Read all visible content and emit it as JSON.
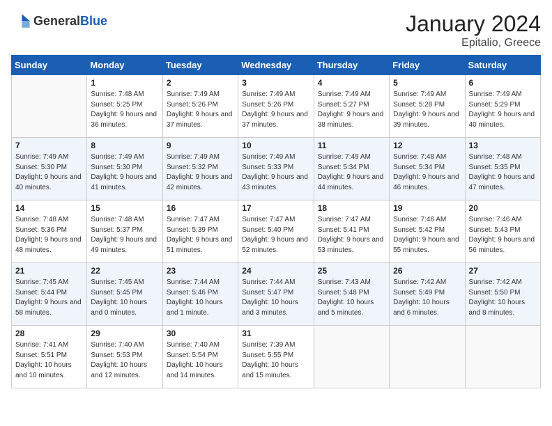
{
  "header": {
    "logo": {
      "general": "General",
      "blue": "Blue"
    },
    "title": "January 2024",
    "subtitle": "Epitalio, Greece"
  },
  "weekdays": [
    "Sunday",
    "Monday",
    "Tuesday",
    "Wednesday",
    "Thursday",
    "Friday",
    "Saturday"
  ],
  "weeks": [
    [
      {
        "day": null
      },
      {
        "day": 1,
        "sunrise": "7:48 AM",
        "sunset": "5:25 PM",
        "daylight": "9 hours and 36 minutes."
      },
      {
        "day": 2,
        "sunrise": "7:49 AM",
        "sunset": "5:26 PM",
        "daylight": "9 hours and 37 minutes."
      },
      {
        "day": 3,
        "sunrise": "7:49 AM",
        "sunset": "5:26 PM",
        "daylight": "9 hours and 37 minutes."
      },
      {
        "day": 4,
        "sunrise": "7:49 AM",
        "sunset": "5:27 PM",
        "daylight": "9 hours and 38 minutes."
      },
      {
        "day": 5,
        "sunrise": "7:49 AM",
        "sunset": "5:28 PM",
        "daylight": "9 hours and 39 minutes."
      },
      {
        "day": 6,
        "sunrise": "7:49 AM",
        "sunset": "5:29 PM",
        "daylight": "9 hours and 40 minutes."
      }
    ],
    [
      {
        "day": 7,
        "sunrise": "7:49 AM",
        "sunset": "5:30 PM",
        "daylight": "9 hours and 40 minutes."
      },
      {
        "day": 8,
        "sunrise": "7:49 AM",
        "sunset": "5:30 PM",
        "daylight": "9 hours and 41 minutes."
      },
      {
        "day": 9,
        "sunrise": "7:49 AM",
        "sunset": "5:32 PM",
        "daylight": "9 hours and 42 minutes."
      },
      {
        "day": 10,
        "sunrise": "7:49 AM",
        "sunset": "5:33 PM",
        "daylight": "9 hours and 43 minutes."
      },
      {
        "day": 11,
        "sunrise": "7:49 AM",
        "sunset": "5:34 PM",
        "daylight": "9 hours and 44 minutes."
      },
      {
        "day": 12,
        "sunrise": "7:48 AM",
        "sunset": "5:34 PM",
        "daylight": "9 hours and 46 minutes."
      },
      {
        "day": 13,
        "sunrise": "7:48 AM",
        "sunset": "5:35 PM",
        "daylight": "9 hours and 47 minutes."
      }
    ],
    [
      {
        "day": 14,
        "sunrise": "7:48 AM",
        "sunset": "5:36 PM",
        "daylight": "9 hours and 48 minutes."
      },
      {
        "day": 15,
        "sunrise": "7:48 AM",
        "sunset": "5:37 PM",
        "daylight": "9 hours and 49 minutes."
      },
      {
        "day": 16,
        "sunrise": "7:47 AM",
        "sunset": "5:39 PM",
        "daylight": "9 hours and 51 minutes."
      },
      {
        "day": 17,
        "sunrise": "7:47 AM",
        "sunset": "5:40 PM",
        "daylight": "9 hours and 52 minutes."
      },
      {
        "day": 18,
        "sunrise": "7:47 AM",
        "sunset": "5:41 PM",
        "daylight": "9 hours and 53 minutes."
      },
      {
        "day": 19,
        "sunrise": "7:46 AM",
        "sunset": "5:42 PM",
        "daylight": "9 hours and 55 minutes."
      },
      {
        "day": 20,
        "sunrise": "7:46 AM",
        "sunset": "5:43 PM",
        "daylight": "9 hours and 56 minutes."
      }
    ],
    [
      {
        "day": 21,
        "sunrise": "7:45 AM",
        "sunset": "5:44 PM",
        "daylight": "9 hours and 58 minutes."
      },
      {
        "day": 22,
        "sunrise": "7:45 AM",
        "sunset": "5:45 PM",
        "daylight": "10 hours and 0 minutes."
      },
      {
        "day": 23,
        "sunrise": "7:44 AM",
        "sunset": "5:46 PM",
        "daylight": "10 hours and 1 minute."
      },
      {
        "day": 24,
        "sunrise": "7:44 AM",
        "sunset": "5:47 PM",
        "daylight": "10 hours and 3 minutes."
      },
      {
        "day": 25,
        "sunrise": "7:43 AM",
        "sunset": "5:48 PM",
        "daylight": "10 hours and 5 minutes."
      },
      {
        "day": 26,
        "sunrise": "7:42 AM",
        "sunset": "5:49 PM",
        "daylight": "10 hours and 6 minutes."
      },
      {
        "day": 27,
        "sunrise": "7:42 AM",
        "sunset": "5:50 PM",
        "daylight": "10 hours and 8 minutes."
      }
    ],
    [
      {
        "day": 28,
        "sunrise": "7:41 AM",
        "sunset": "5:51 PM",
        "daylight": "10 hours and 10 minutes."
      },
      {
        "day": 29,
        "sunrise": "7:40 AM",
        "sunset": "5:53 PM",
        "daylight": "10 hours and 12 minutes."
      },
      {
        "day": 30,
        "sunrise": "7:40 AM",
        "sunset": "5:54 PM",
        "daylight": "10 hours and 14 minutes."
      },
      {
        "day": 31,
        "sunrise": "7:39 AM",
        "sunset": "5:55 PM",
        "daylight": "10 hours and 15 minutes."
      },
      {
        "day": null
      },
      {
        "day": null
      },
      {
        "day": null
      }
    ]
  ]
}
